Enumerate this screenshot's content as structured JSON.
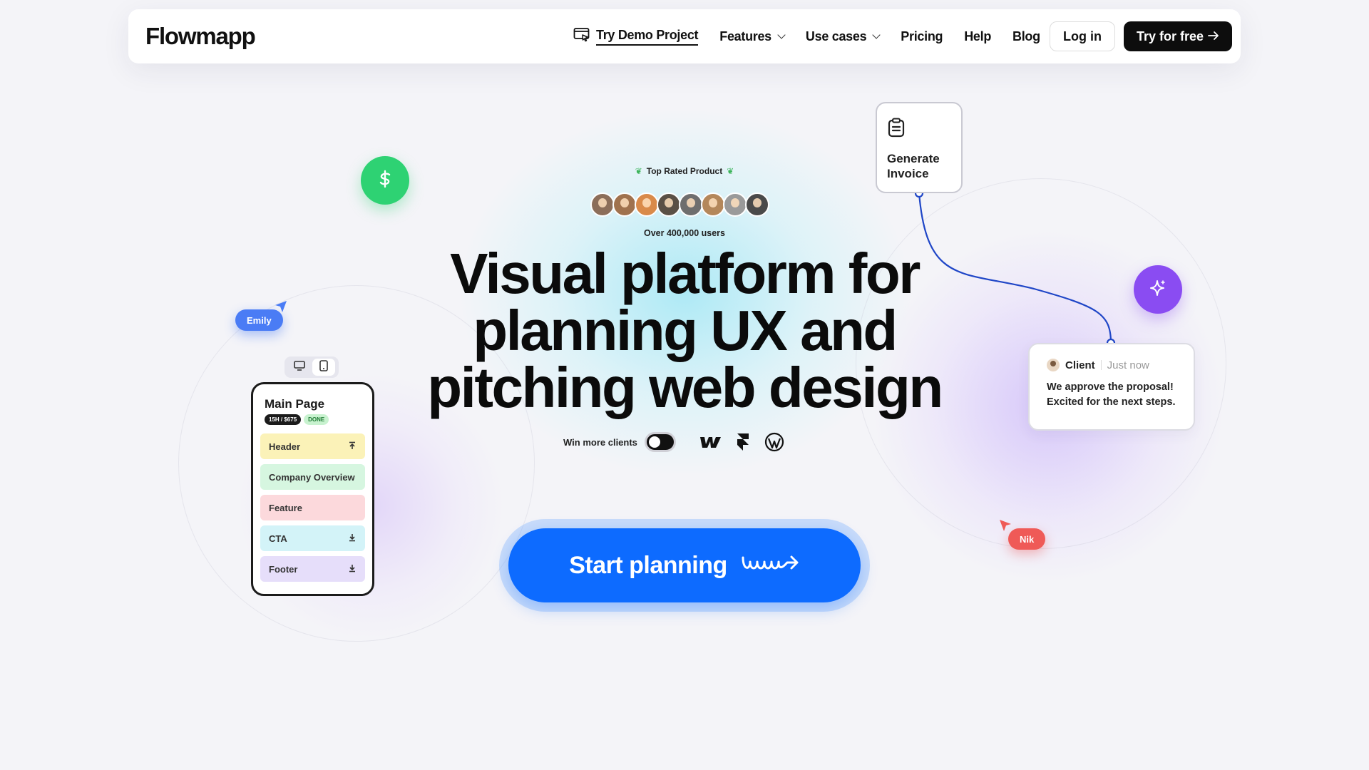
{
  "nav": {
    "logo": "Flowmapp",
    "demo_label": "Try Demo Project",
    "features_label": "Features",
    "use_cases_label": "Use cases",
    "pricing_label": "Pricing",
    "help_label": "Help",
    "blog_label": "Blog",
    "login_label": "Log in",
    "try_label": "Try for free"
  },
  "hero": {
    "top_rated": "Top Rated Product",
    "users": "Over 400,000 users",
    "title_lines": [
      "Visual platform for",
      "planning UX and",
      "pitching web design"
    ],
    "win_label": "Win more clients",
    "cta_label": "Start planning"
  },
  "floating": {
    "invoice_label": "Generate Invoice",
    "client_name": "Client",
    "client_time": "Just now",
    "client_msg_line1": "We approve the proposal!",
    "client_msg_line2": "Excited for the next steps.",
    "tag_emily": "Emily",
    "tag_nik": "Nik"
  },
  "phone": {
    "title": "Main Page",
    "badge_budget": "15H / $675",
    "badge_status": "DONE",
    "sections": [
      {
        "label": "Header",
        "bg": "#fbf2b8",
        "icon": "arrow-up-icon"
      },
      {
        "label": "Company Overview",
        "bg": "#d6f6e0",
        "icon": ""
      },
      {
        "label": "Feature",
        "bg": "#fcd9dc",
        "icon": ""
      },
      {
        "label": "CTA",
        "bg": "#d3f3f8",
        "icon": "arrow-down-icon"
      },
      {
        "label": "Footer",
        "bg": "#e6defa",
        "icon": "arrow-down-icon"
      }
    ]
  },
  "avatars": [
    "#8c6e5a",
    "#a0724e",
    "#d98a4a",
    "#5a5046",
    "#6e6e6e",
    "#b4875a",
    "#9a9a9a",
    "#4a4a4a"
  ],
  "colors": {
    "accent": "#0d6bff",
    "green": "#2ed273",
    "purple": "#8a4cf2",
    "emily": "#4a7cf5",
    "nik": "#ef5a57"
  }
}
